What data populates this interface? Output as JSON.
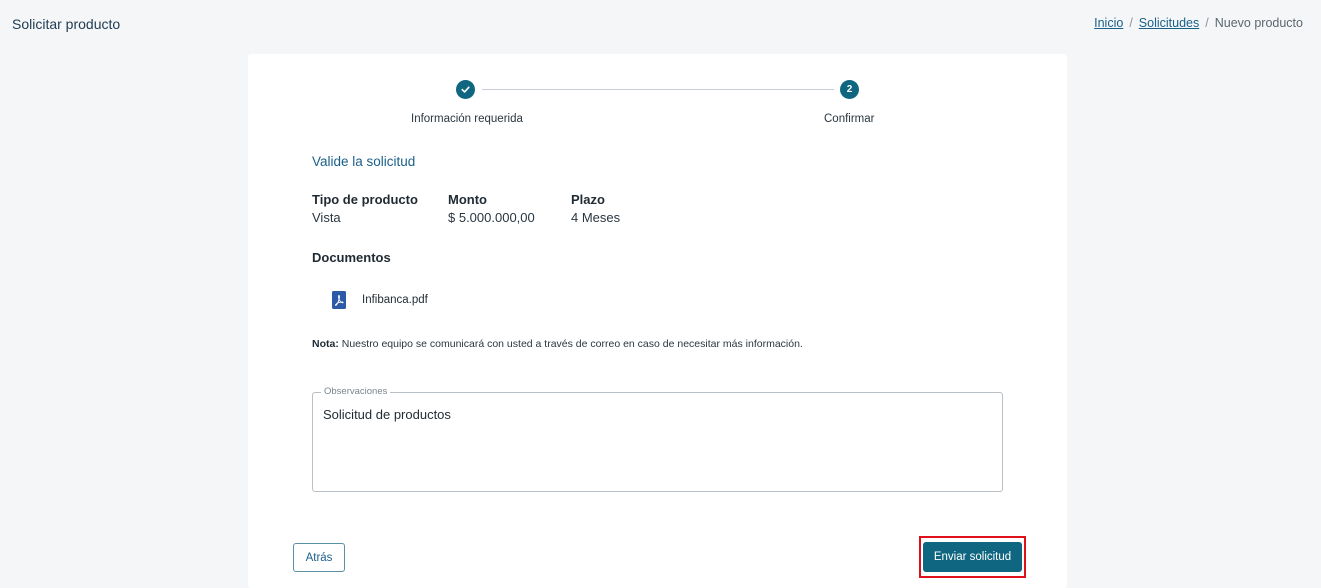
{
  "header": {
    "title": "Solicitar producto",
    "breadcrumb": {
      "home": "Inicio",
      "separator": "/",
      "requests": "Solicitudes",
      "current": "Nuevo producto"
    }
  },
  "stepper": {
    "steps": [
      {
        "label": "Información requerida",
        "state": "completed",
        "icon": "check-icon"
      },
      {
        "label": "Confirmar",
        "state": "active",
        "number": "2"
      }
    ]
  },
  "summary": {
    "title": "Valide la solicitud",
    "fields": [
      {
        "label": "Tipo de producto",
        "value": "Vista"
      },
      {
        "label": "Monto",
        "value": "$ 5.000.000,00"
      },
      {
        "label": "Plazo",
        "value": "4 Meses"
      }
    ]
  },
  "documents": {
    "title": "Documentos",
    "items": [
      {
        "name": "Infibanca.pdf",
        "icon": "pdf-icon"
      }
    ]
  },
  "note": {
    "prefix": "Nota:",
    "text": " Nuestro equipo se comunicará con usted a través de correo en caso de necesitar más información."
  },
  "observations": {
    "label": "Observaciones",
    "value": "Solicitud de productos"
  },
  "actions": {
    "back_label": "Atrás",
    "submit_label": "Enviar solicitud"
  },
  "colors": {
    "primary": "#0f6680",
    "link": "#1a5f8a",
    "highlight": "#e0101a",
    "pdf": "#2d5aa8"
  }
}
